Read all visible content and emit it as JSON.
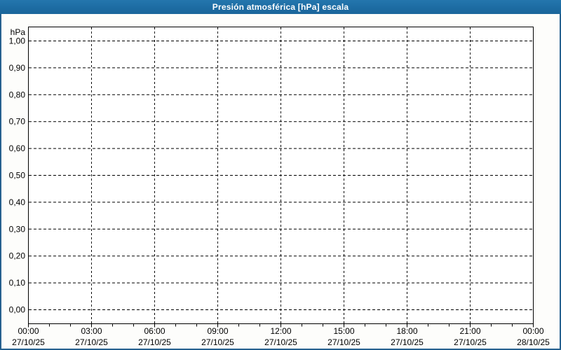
{
  "window": {
    "title": "Presión atmosférica [hPa] escala"
  },
  "colors": {
    "titlebar_bg": "#1d6ca3",
    "titlebar_text": "#ffffff",
    "frame_border": "#26618f",
    "background": "#fdfdfb",
    "plot_bg": "#ffffff",
    "axis": "#000000",
    "grid": "#000000",
    "label_text": "#000000"
  },
  "chart_data": {
    "type": "line",
    "title": "Presión atmosférica [hPa] escala",
    "grid": "dashed",
    "legend_position": "none",
    "series": [],
    "y_axis": {
      "unit_label": "hPa",
      "min": 0.0,
      "max": 1.0,
      "step": 0.1,
      "decimal_separator": ",",
      "tick_labels": [
        "1,00",
        "0,90",
        "0,80",
        "0,70",
        "0,60",
        "0,50",
        "0,40",
        "0,30",
        "0,20",
        "0,10",
        "0,00"
      ]
    },
    "x_axis": {
      "span_hours": 24,
      "minor_tick_hours": 1,
      "major_tick_hours": 3,
      "major_ticks": [
        {
          "time": "00:00",
          "date": "27/10/25"
        },
        {
          "time": "03:00",
          "date": "27/10/25"
        },
        {
          "time": "06:00",
          "date": "27/10/25"
        },
        {
          "time": "09:00",
          "date": "27/10/25"
        },
        {
          "time": "12:00",
          "date": "27/10/25"
        },
        {
          "time": "15:00",
          "date": "27/10/25"
        },
        {
          "time": "18:00",
          "date": "27/10/25"
        },
        {
          "time": "21:00",
          "date": "27/10/25"
        },
        {
          "time": "00:00",
          "date": "28/10/25"
        }
      ]
    }
  }
}
